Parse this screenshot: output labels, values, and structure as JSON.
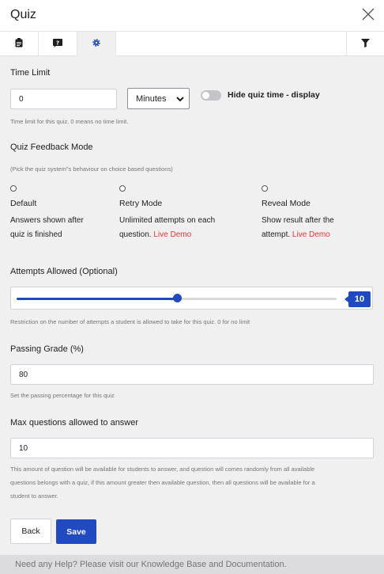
{
  "header": {
    "title": "Quiz"
  },
  "tabs": [
    {
      "icon": "clipboard-icon"
    },
    {
      "icon": "question-icon"
    },
    {
      "icon": "gear-icon",
      "active": true
    }
  ],
  "filter_icon": "filter-icon",
  "time_limit": {
    "label": "Time Limit",
    "value": "0",
    "unit": "Minutes",
    "toggle_label": "Hide quiz time - display",
    "toggle_on": false,
    "help": "Time limit for this quiz. 0 means no time limit."
  },
  "feedback": {
    "label": "Quiz Feedback Mode",
    "help": "(Pick the quiz system\"s behaviour on choice based questions)",
    "options": [
      {
        "title": "Default",
        "desc_line1": "Answers shown after",
        "desc_line2": "quiz is finished",
        "live": ""
      },
      {
        "title": "Retry Mode",
        "desc_line1": "Unlimited attempts on each",
        "desc_line2": "question.",
        "live": "Live Demo"
      },
      {
        "title": "Reveal Mode",
        "desc_line1": "Show result after the",
        "desc_line2": "attempt.",
        "live": "Live Demo"
      }
    ]
  },
  "attempts": {
    "label": "Attempts Allowed (Optional)",
    "value": "10",
    "fill_fraction": 0.5,
    "help": "Restriction on the number of attempts a student is allowed to take for this quiz. 0 for no limit"
  },
  "passing": {
    "label": "Passing Grade (%)",
    "value": "80",
    "help": "Set the passing percentage for this quiz"
  },
  "max_questions": {
    "label": "Max questions allowed to answer",
    "value": "10",
    "help_line1": "This amount of question will be available for students to answer, and question will comes randomly from all available",
    "help_line2": "questions belongs with a quiz, if this amount greater then available question, then all questions will be available for a",
    "help_line3": "student to answer."
  },
  "buttons": {
    "back": "Back",
    "save": "Save"
  },
  "footer": {
    "text": "Need any Help? Please visit our Knowledge Base and Documentation."
  },
  "colors": {
    "accent": "#2149c0",
    "link_red": "#e53935"
  }
}
